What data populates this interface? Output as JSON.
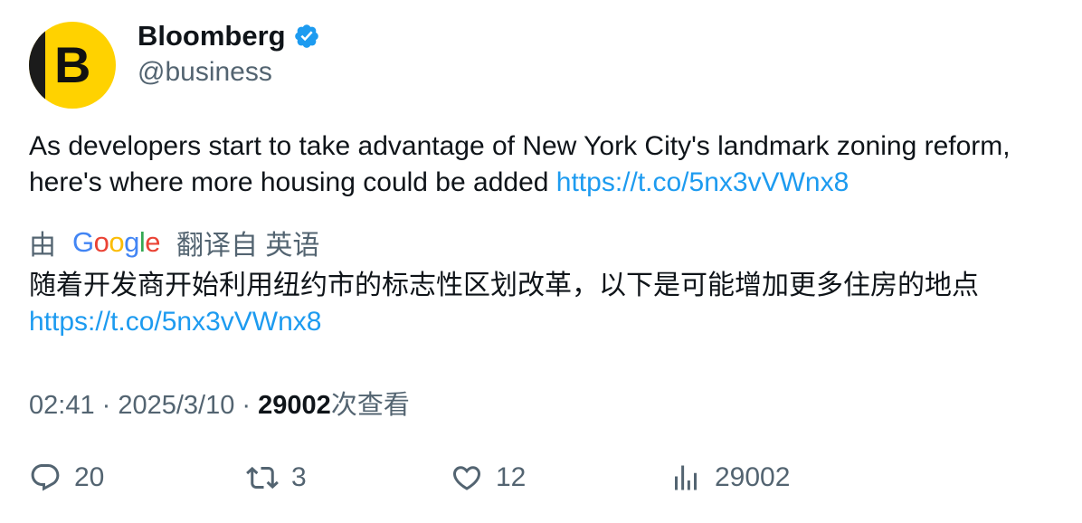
{
  "author": {
    "avatar_letter": "B",
    "name": "Bloomberg",
    "handle": "@business",
    "verified_icon": "verified-badge-icon"
  },
  "tweet": {
    "text": "As developers start to take advantage of New York City's landmark zoning reform, here's where more housing could be added ",
    "link": "https://t.co/5nx3vVWnx8"
  },
  "translation": {
    "prefix": "由",
    "provider_letters": [
      "G",
      "o",
      "o",
      "g",
      "l",
      "e"
    ],
    "suffix": "翻译自 英语",
    "text": "随着开发商开始利用纽约市的标志性区划改革，以下是可能增加更多住房的地点",
    "link": "https://t.co/5nx3vVWnx8"
  },
  "meta": {
    "time": "02:41",
    "separator": " · ",
    "date": "2025/3/10",
    "views_count": "29002",
    "views_label": "次查看"
  },
  "actions": {
    "replies": "20",
    "retweets": "3",
    "likes": "12",
    "views": "29002"
  },
  "colors": {
    "link": "#1d9bf0",
    "secondary_text": "#536471",
    "verified": "#1d9bf0",
    "avatar_bg": "#ffd200"
  }
}
